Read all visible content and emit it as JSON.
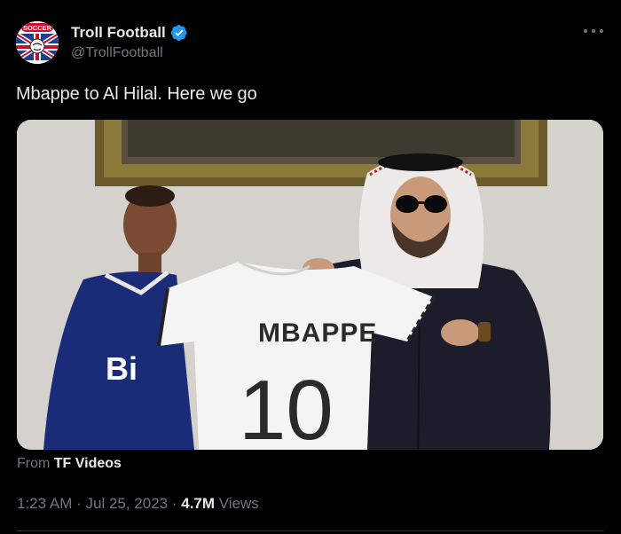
{
  "author": {
    "name": "Troll Football",
    "handle": "@TrollFootball",
    "verified": true,
    "verified_color": "#1d9bf0",
    "avatar_logo_text": "SOCCER"
  },
  "tweet": {
    "text": "Mbappe to Al Hilal. Here we go"
  },
  "media": {
    "jersey_name": "MBAPPE",
    "jersey_number": "10",
    "shirt_sponsor_partial": "Bi"
  },
  "source": {
    "prefix": "From",
    "name": "TF Videos"
  },
  "meta": {
    "time": "1:23 AM",
    "separator1": " · ",
    "date": "Jul 25, 2023",
    "separator2": " · ",
    "views_count": "4.7M",
    "views_label": "Views"
  },
  "icons": {
    "more": "more-horizontal-icon",
    "verified": "verified-badge-icon"
  },
  "colors": {
    "background": "#000000",
    "text_primary": "#e7e9ea",
    "text_secondary": "#71767b"
  }
}
